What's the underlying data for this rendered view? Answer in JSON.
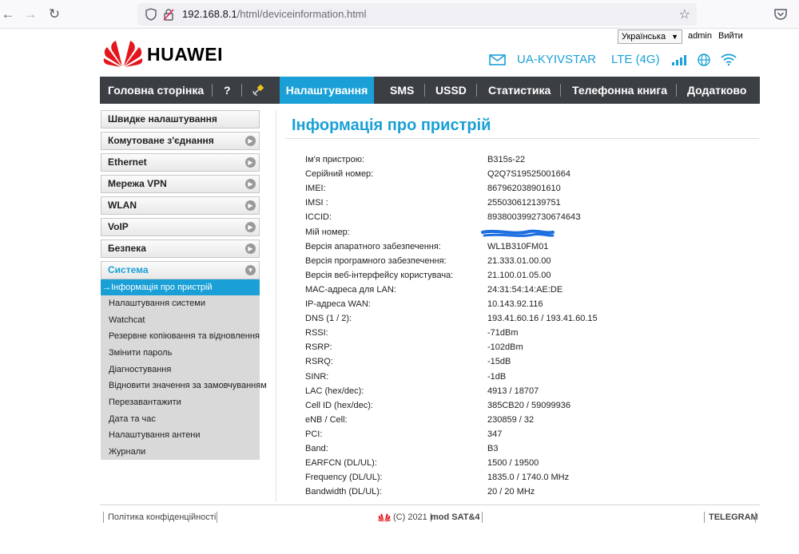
{
  "browser": {
    "url_host": "192.168.8.1",
    "url_path": "/html/deviceinformation.html"
  },
  "header": {
    "language": "Українська",
    "user": "admin",
    "logout": "Вийти",
    "brand": "HUAWEI",
    "operator": "UA-KYIVSTAR",
    "network": "LTE (4G)",
    "accent_color": "#1aa0d6"
  },
  "topnav": {
    "tabs": [
      "Головна сторінка",
      "?",
      "",
      "Налаштування",
      "SMS",
      "USSD",
      "Статистика",
      "Телефонна книга",
      "Додатково"
    ],
    "active_tab": "Налаштування"
  },
  "sidebar": {
    "items": [
      "Швидке налаштування",
      "Комутоване з'єднання",
      "Ethernet",
      "Мережа VPN",
      "WLAN",
      "VoIP",
      "Безпека",
      "Система"
    ],
    "submenu": [
      "Інформація про пристрій",
      "Налаштування системи",
      "Watchcat",
      "Резервне копіювання та відновлення",
      "Змінити пароль",
      "Діагностування",
      "Відновити значення за замовчуванням",
      "Перезавантажити",
      "Дата та час",
      "Налаштування антени",
      "Журнали"
    ]
  },
  "main": {
    "title": "Інформація про пристрій",
    "rows": [
      {
        "label": "Ім'я пристрою:",
        "value": "B315s-22"
      },
      {
        "label": "Серійний номер:",
        "value": "Q2Q7S19525001664"
      },
      {
        "label": "IMEI:",
        "value": "867962038901610"
      },
      {
        "label": "IMSI :",
        "value": "255030612139751"
      },
      {
        "label": "ICCID:",
        "value": "893800399273067464З"
      },
      {
        "label": "Мій номер:",
        "value": ""
      },
      {
        "label": "Версія апаратного забезпечення:",
        "value": "WL1B310FM01"
      },
      {
        "label": "Версія програмного забезпечення:",
        "value": "21.333.01.00.00"
      },
      {
        "label": "Версія веб-інтерфейсу користувача:",
        "value": "21.100.01.05.00"
      },
      {
        "label": "MAC-адреса для LAN:",
        "value": "24:31:54:14:AE:DE"
      },
      {
        "label": "IP-адреса WAN:",
        "value": "10.143.92.116"
      },
      {
        "label": "DNS (1 / 2):",
        "value": "193.41.60.16 / 193.41.60.15"
      },
      {
        "label": "RSSI:",
        "value": "-71dBm"
      },
      {
        "label": "RSRP:",
        "value": "-102dBm"
      },
      {
        "label": "RSRQ:",
        "value": "-15dB"
      },
      {
        "label": "SINR:",
        "value": "-1dB"
      },
      {
        "label": "LAC (hex/dec):",
        "value": "4913 / 18707"
      },
      {
        "label": "Cell ID (hex/dec):",
        "value": "385CB20 / 59099936"
      },
      {
        "label": "eNB / Cell:",
        "value": "230859 / 32"
      },
      {
        "label": "PCI:",
        "value": "347"
      },
      {
        "label": "Band:",
        "value": "B3"
      },
      {
        "label": "EARFCN (DL/UL):",
        "value": "1500 / 19500"
      },
      {
        "label": "Frequency (DL/UL):",
        "value": "1835.0 / 1740.0 MHz"
      },
      {
        "label": "Bandwidth (DL/UL):",
        "value": "20 / 20 MHz"
      }
    ]
  },
  "footer": {
    "privacy": "Політика конфіденційності",
    "copyright": "(C) 2021 |",
    "mod": "mod SAT&4",
    "telegram": "TELEGRAM"
  }
}
